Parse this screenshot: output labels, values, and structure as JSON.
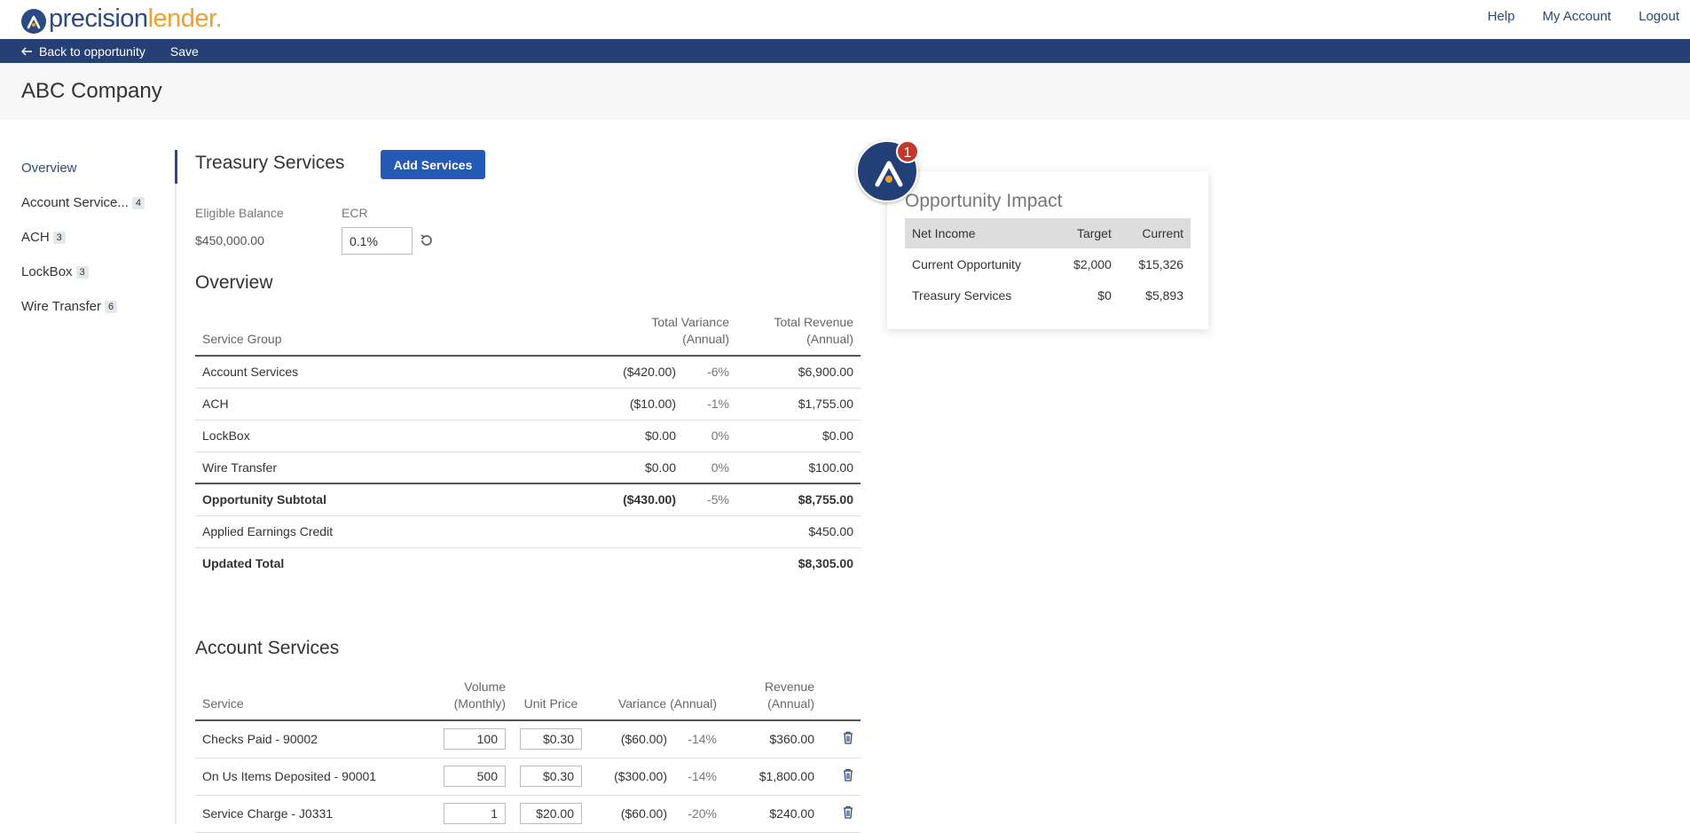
{
  "header": {
    "logo_part1": "precision",
    "logo_part2": "lender.",
    "links": [
      "Help",
      "My Account",
      "Logout"
    ]
  },
  "actionbar": {
    "back_label": "Back to opportunity",
    "save_label": "Save"
  },
  "page_title": "ABC Company",
  "sidebar": {
    "items": [
      {
        "label": "Overview",
        "badge": ""
      },
      {
        "label": "Account Service...",
        "badge": "4"
      },
      {
        "label": "ACH",
        "badge": "3"
      },
      {
        "label": "LockBox",
        "badge": "3"
      },
      {
        "label": "Wire Transfer",
        "badge": "6"
      }
    ]
  },
  "treasury": {
    "title": "Treasury Services",
    "add_button": "Add Services",
    "eligible_balance_label": "Eligible Balance",
    "eligible_balance_value": "$450,000.00",
    "ecr_label": "ECR",
    "ecr_value": "0.1%"
  },
  "overview": {
    "title": "Overview",
    "headers": {
      "service_group": "Service Group",
      "total_variance_1": "Total Variance",
      "total_variance_2": "(Annual)",
      "total_revenue_1": "Total Revenue",
      "total_revenue_2": "(Annual)"
    },
    "rows": [
      {
        "group": "Account Services",
        "variance": "($420.00)",
        "pct": "-6%",
        "revenue": "$6,900.00"
      },
      {
        "group": "ACH",
        "variance": "($10.00)",
        "pct": "-1%",
        "revenue": "$1,755.00"
      },
      {
        "group": "LockBox",
        "variance": "$0.00",
        "pct": "0%",
        "revenue": "$0.00"
      },
      {
        "group": "Wire Transfer",
        "variance": "$0.00",
        "pct": "0%",
        "revenue": "$100.00"
      }
    ],
    "subtotal": {
      "label": "Opportunity Subtotal",
      "variance": "($430.00)",
      "pct": "-5%",
      "revenue": "$8,755.00"
    },
    "earnings_credit": {
      "label": "Applied Earnings Credit",
      "revenue": "$450.00"
    },
    "updated_total": {
      "label": "Updated Total",
      "revenue": "$8,305.00"
    }
  },
  "account_services": {
    "title": "Account Services",
    "headers": {
      "service": "Service",
      "volume_1": "Volume",
      "volume_2": "(Monthly)",
      "unit_price": "Unit Price",
      "variance": "Variance (Annual)",
      "revenue_1": "Revenue",
      "revenue_2": "(Annual)"
    },
    "rows": [
      {
        "service": "Checks Paid - 90002",
        "volume": "100",
        "unit_price": "$0.30",
        "variance": "($60.00)",
        "pct": "-14%",
        "revenue": "$360.00"
      },
      {
        "service": "On Us Items Deposited - 90001",
        "volume": "500",
        "unit_price": "$0.30",
        "variance": "($300.00)",
        "pct": "-14%",
        "revenue": "$1,800.00"
      },
      {
        "service": "Service Charge - J0331",
        "volume": "1",
        "unit_price": "$20.00",
        "variance": "($60.00)",
        "pct": "-20%",
        "revenue": "$240.00"
      }
    ]
  },
  "impact": {
    "title": "Opportunity Impact",
    "headers": {
      "name": "Net Income",
      "target": "Target",
      "current": "Current"
    },
    "rows": [
      {
        "name": "Current Opportunity",
        "target": "$2,000",
        "current": "$15,326"
      },
      {
        "name": "Treasury Services",
        "target": "$0",
        "current": "$5,893"
      }
    ],
    "notification_count": "1"
  },
  "colors": {
    "brand_navy": "#263f74",
    "brand_orange": "#f0a030",
    "button_blue": "#2459b6",
    "notification_red": "#c0392b"
  }
}
